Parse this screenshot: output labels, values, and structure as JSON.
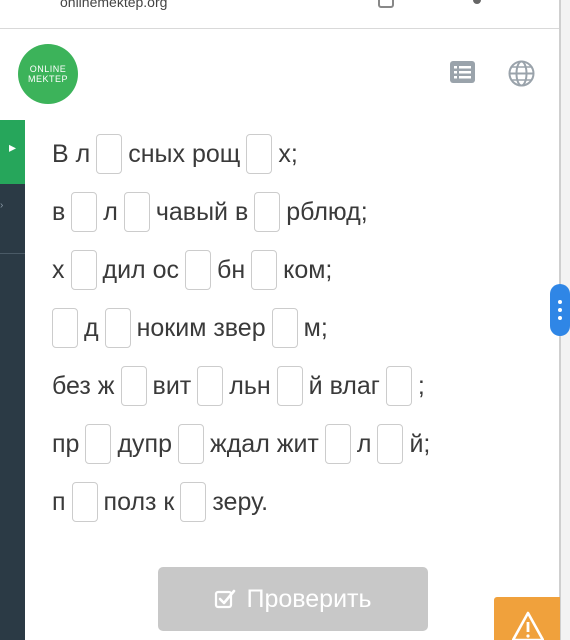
{
  "browser": {
    "url": "onlinemektep.org"
  },
  "logo": {
    "line1": "ONLINE",
    "line2": "MEKTEP"
  },
  "icons": {
    "list": "list-icon",
    "globe": "globe-icon",
    "warning": "warning-icon",
    "check": "checkbox-icon",
    "play": "play-icon"
  },
  "exercise": {
    "line1": {
      "a": "В л",
      "b": "сных рощ",
      "c": "х;"
    },
    "line2": {
      "a": "в",
      "b": "л",
      "c": "чавый в",
      "d": "рблюд;"
    },
    "line3": {
      "a": "х",
      "b": "дил ос",
      "c": "бн",
      "d": "ком;"
    },
    "line4": {
      "a": "д",
      "b": "ноким звер",
      "c": "м;"
    },
    "line5": {
      "a": "без ж",
      "b": "вит",
      "c": "льн",
      "d": "й влаг",
      "e": ";"
    },
    "line6": {
      "a": "пр",
      "b": "дупр",
      "c": "ждал жит",
      "d": "л",
      "e": "й;"
    },
    "line7": {
      "a": "п",
      "b": "полз к",
      "c": "зеру."
    }
  },
  "check_button": {
    "label": "Проверить"
  },
  "colors": {
    "brand_green": "#3cb35a",
    "sidebar": "#2b3a45",
    "accent_blue": "#2f86e6",
    "button_disabled": "#c8c8c8",
    "warning": "#f0a13c"
  }
}
